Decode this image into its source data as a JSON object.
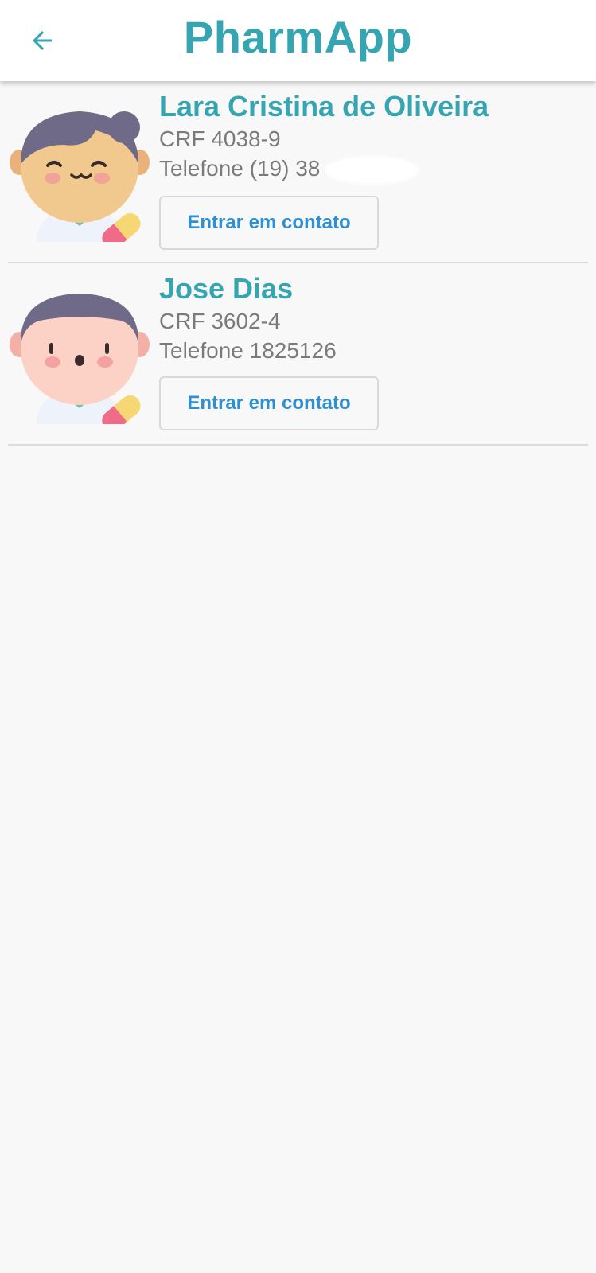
{
  "appbar": {
    "title": "PharmApp",
    "back_icon": "arrow-left-icon"
  },
  "colors": {
    "accent": "#35a5b2",
    "button_text": "#2f8fcf",
    "muted_text": "#7a7a7a"
  },
  "pharmacists": [
    {
      "name": "Lara Cristina  de Oliveira",
      "crf": "CRF 4038-9",
      "phone": "Telefone (19) 38",
      "phone_redacted": true,
      "button_label": "Entrar em contato",
      "avatar_icon": "female-pharmacist-avatar-icon"
    },
    {
      "name": "Jose Dias",
      "crf": "CRF 3602-4",
      "phone": "Telefone 1825126",
      "phone_redacted": false,
      "button_label": "Entrar em contato",
      "avatar_icon": "male-pharmacist-avatar-icon"
    }
  ]
}
